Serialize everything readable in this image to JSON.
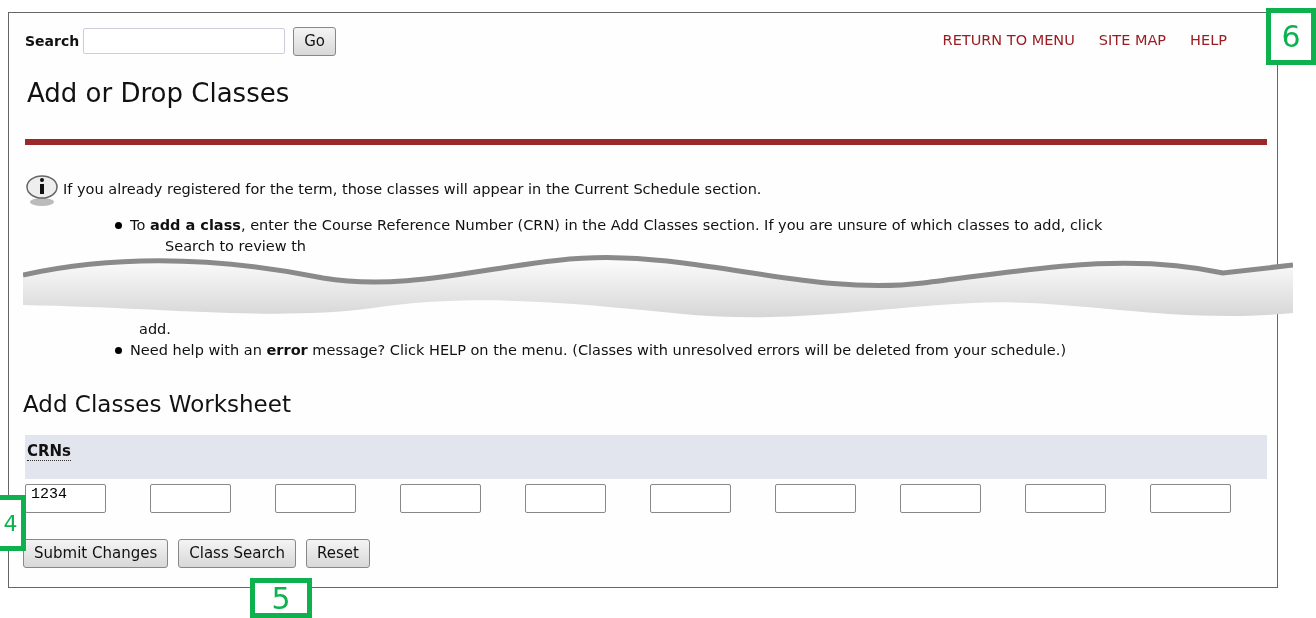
{
  "search": {
    "label": "Search",
    "button": "Go"
  },
  "top_links": [
    "RETURN TO MENU",
    "SITE MAP",
    "HELP"
  ],
  "title": "Add or Drop Classes",
  "info": "If you already registered for the term, those classes will appear in the Current Schedule section.",
  "bullets": [
    {
      "kind": "item",
      "text": "To **add a class**, enter the Course Reference Number (CRN) in the Add Classes section. If you are unsure of which classes to add, click"
    },
    {
      "kind": "fragment",
      "text": "Search to review th"
    },
    {
      "kind": "tear"
    },
    {
      "kind": "fragment",
      "text": "add."
    },
    {
      "kind": "item",
      "text": "Need help with an **error** message? Click HELP on the menu. (Classes with unresolved errors will be deleted from your schedule.)"
    }
  ],
  "worksheet": {
    "title": "Add Classes Worksheet",
    "header": "CRNs",
    "fields": [
      {
        "kind": "filled",
        "value": "1234"
      },
      {
        "kind": "empty"
      },
      {
        "kind": "empty"
      },
      {
        "kind": "empty"
      },
      {
        "kind": "empty"
      },
      {
        "kind": "empty"
      },
      {
        "kind": "empty"
      },
      {
        "kind": "empty"
      },
      {
        "kind": "empty"
      },
      {
        "kind": "empty"
      }
    ]
  },
  "buttons": [
    "Submit Changes",
    "Class Search",
    "Reset"
  ],
  "callouts": [
    {
      "label": "6"
    },
    {
      "label": "4"
    },
    {
      "label": "5"
    }
  ]
}
